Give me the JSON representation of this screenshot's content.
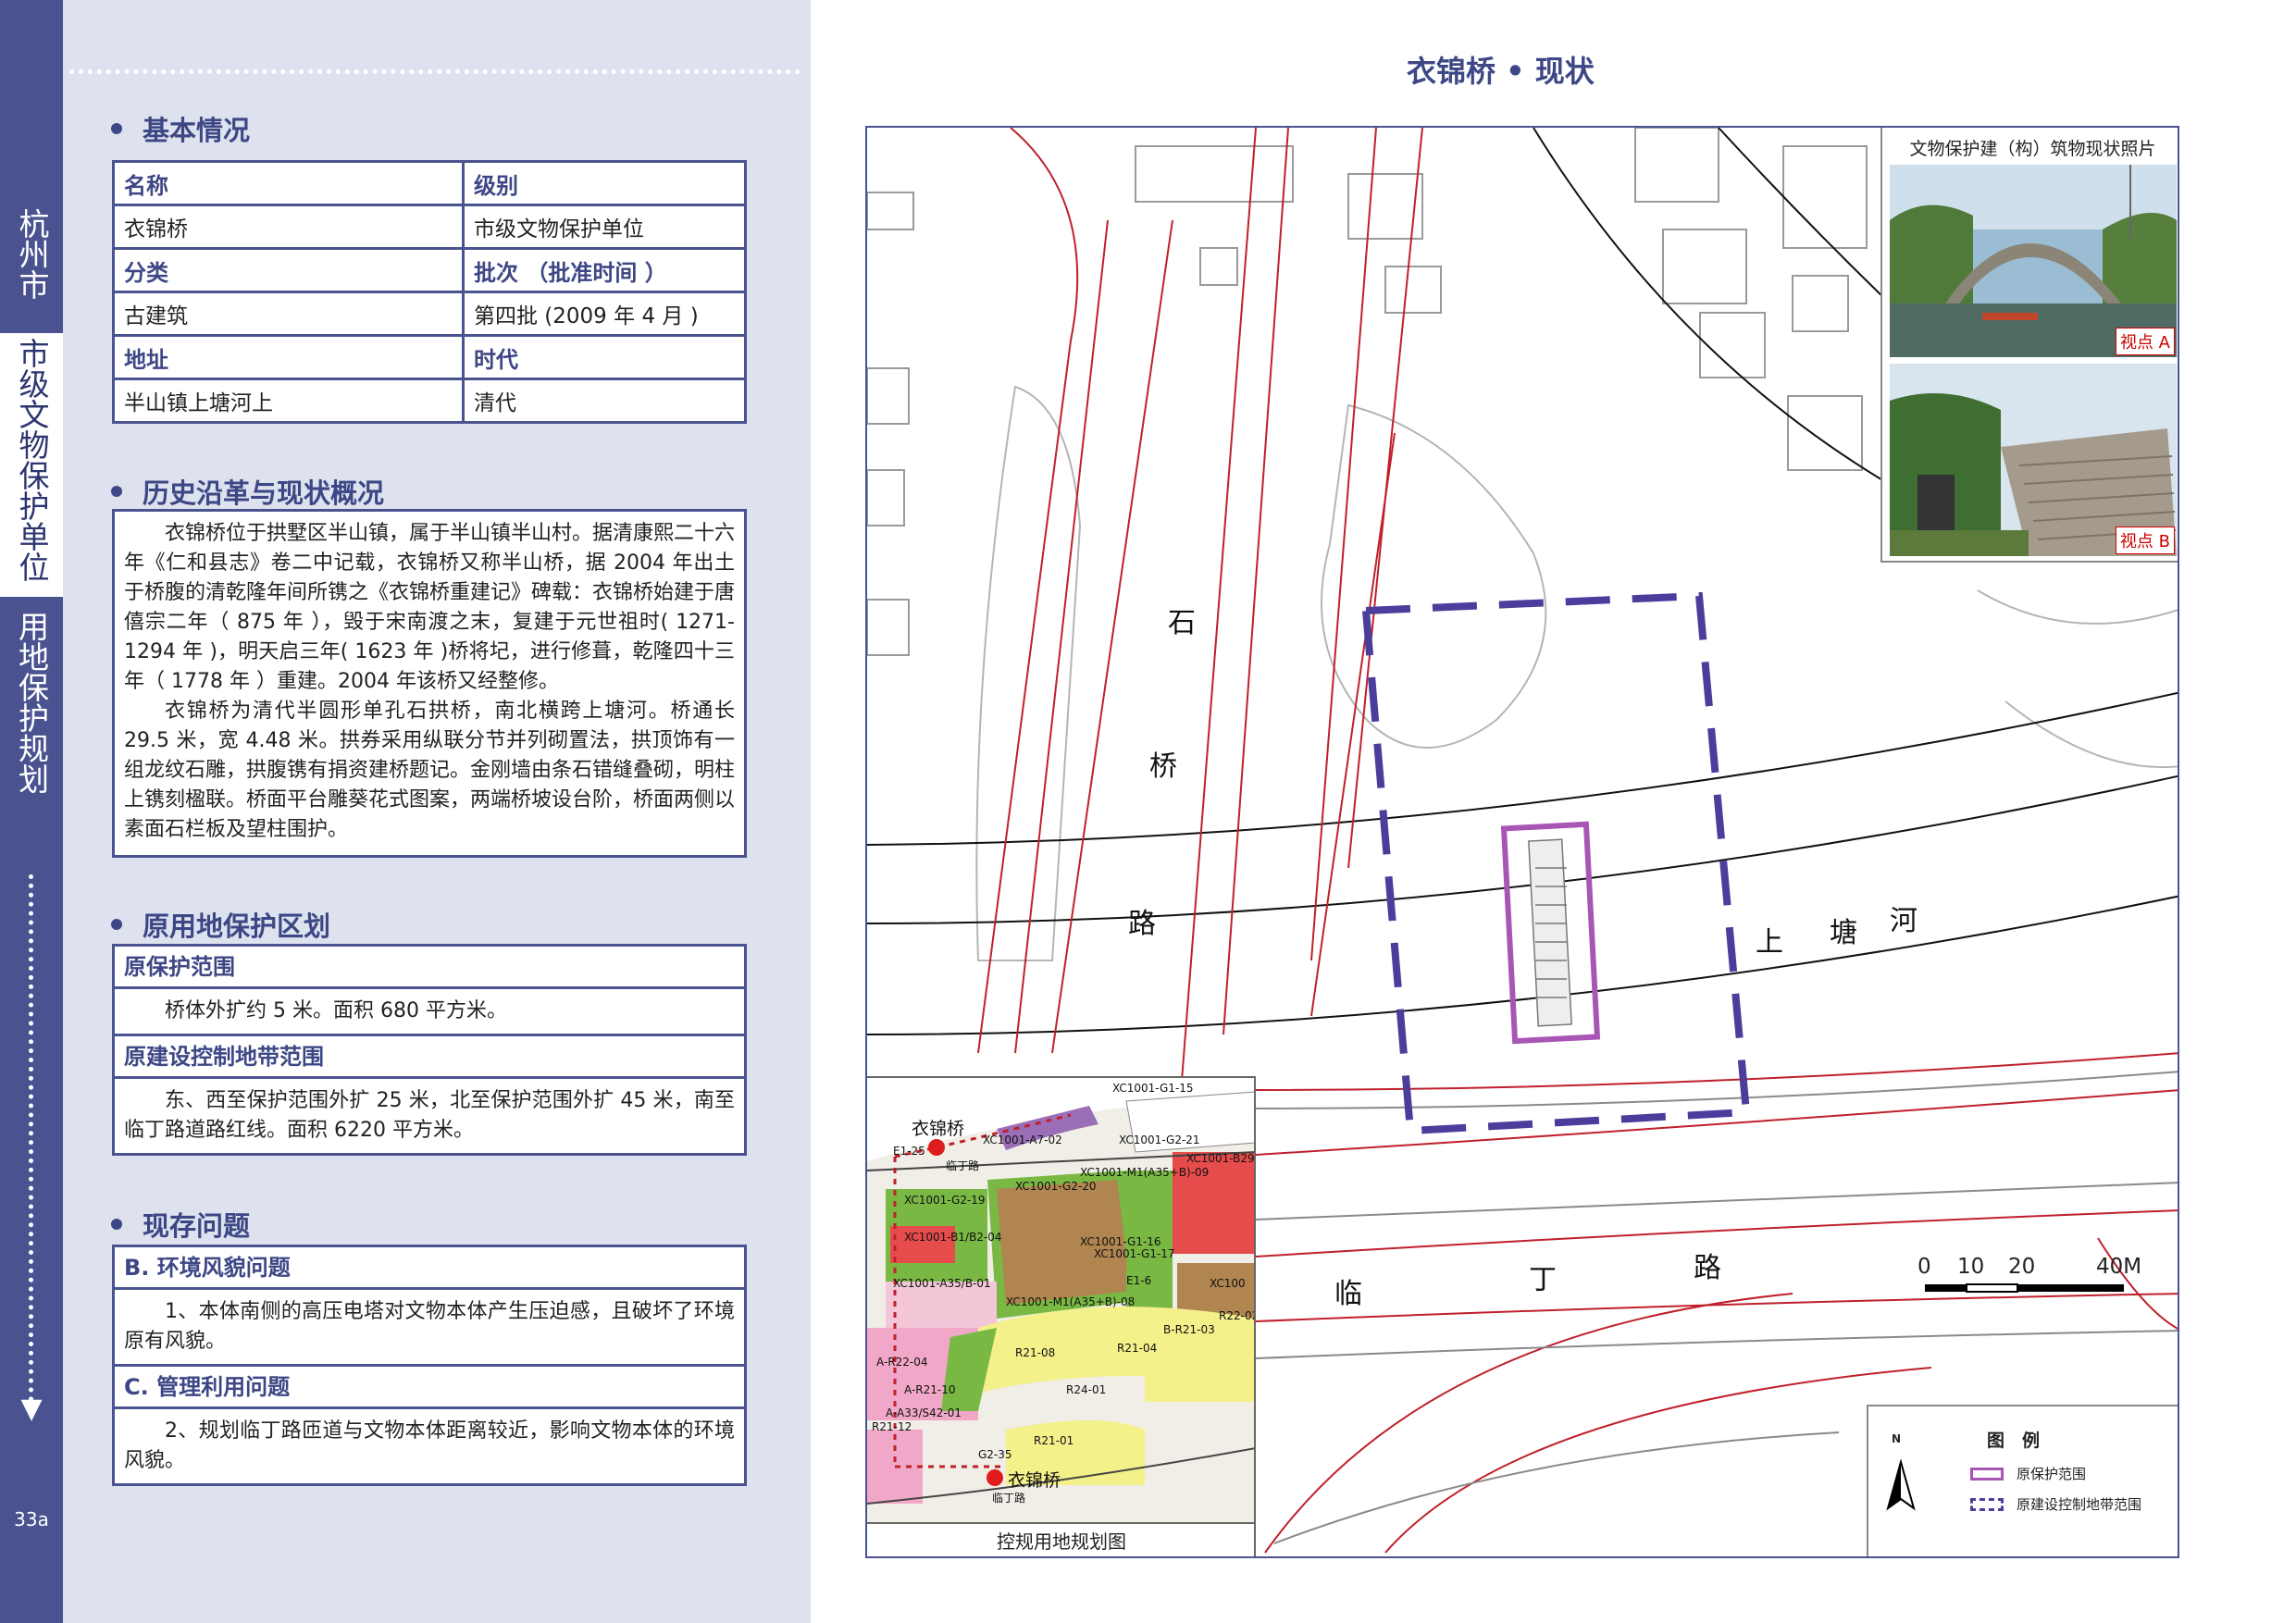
{
  "sidebar": {
    "city": "杭州市",
    "category": "市级文物保护单位",
    "plan": "用地保护规划",
    "page_number": "33a"
  },
  "sections": {
    "basic": "基本情况",
    "history": "历史沿革与现状概况",
    "protection": "原用地保护区划",
    "issues": "现存问题"
  },
  "basic_table": {
    "h_name": "名称",
    "h_level": "级别",
    "name": "衣锦桥",
    "level": "市级文物保护单位",
    "h_type": "分类",
    "h_batch": "批次 （批准时间 ）",
    "type": "古建筑",
    "batch": "第四批 (2009 年 4 月 )",
    "h_address": "地址",
    "h_era": "时代",
    "address": "半山镇上塘河上",
    "era": "清代"
  },
  "history_text": {
    "p1": "衣锦桥位于拱墅区半山镇，属于半山镇半山村。据清康熙二十六年《仁和县志》卷二中记载，衣锦桥又称半山桥，据 2004 年出土于桥腹的清乾隆年间所镌之《衣锦桥重建记》碑载：衣锦桥始建于唐僖宗二年（ 875 年 ），毁于宋南渡之末，复建于元世祖时( 1271-1294 年 )，明天启三年( 1623 年 )桥将圮，进行修葺，乾隆四十三年（ 1778 年 ）重建。2004 年该桥又经整修。",
    "p2": "衣锦桥为清代半圆形单孔石拱桥，南北横跨上塘河。桥通长 29.5 米，宽 4.48 米。拱券采用纵联分节并列砌置法，拱顶饰有一组龙纹石雕，拱腹镌有捐资建桥题记。金刚墙由条石错缝叠砌，明柱上镌刻楹联。桥面平台雕葵花式图案，两端桥坡设台阶，桥面两侧以素面石栏板及望柱围护。"
  },
  "protection": {
    "orig_scope_title": "原保护范围",
    "orig_scope_text": "桥体外扩约 5 米。面积 680 平方米。",
    "control_title": "原建设控制地带范围",
    "control_text": "东、西至保护范围外扩 25 米，北至保护范围外扩 45 米，南至临丁路道路红线。面积 6220 平方米。"
  },
  "issues": {
    "b_title": "B. 环境风貌问题",
    "b_text": "1、本体南侧的高压电塔对文物本体产生压迫感，且破坏了环境原有风貌。",
    "c_title": "C. 管理利用问题",
    "c_text": "2、规划临丁路匝道与文物本体距离较近，影响文物本体的环境风貌。"
  },
  "page_title": "衣锦桥 • 现状",
  "map": {
    "road_shiqiao": [
      "石",
      "桥",
      "路"
    ],
    "river": [
      "上",
      "塘",
      "河"
    ],
    "road_linding": [
      "临",
      "丁",
      "路"
    ],
    "photo_title": "文物保护建（构）筑物现状照片",
    "view_a": "视点 A",
    "view_b": "视点 B",
    "scale_labels": [
      "0",
      "10",
      "20",
      "40M"
    ],
    "legend_title": "图　例",
    "legend_protect": "原保护范围",
    "legend_control": "原建设控制地带范围",
    "north": "N",
    "inset_caption": "控规用地规划图",
    "inset_bridge_top": "衣锦桥",
    "inset_bridge_bottom": "衣锦桥",
    "inset_road_top": "临丁路",
    "inset_road_bottom": "临丁路",
    "inset_codes": [
      "XC1001-G1-15",
      "XC1001-A7-02",
      "XC1001-G2-21",
      "XC1001-B29-",
      "XC1001-M1(A35+B)-09",
      "XC1001-G2-19",
      "XC1001-G2-20",
      "XC1001-B1/B2-04",
      "XC1001-G1-16",
      "XC1001-G1-17",
      "XC1001-A35/B-01",
      "XC1001-M1(A35+B)-08",
      "E1-6",
      "XC100",
      "R21-08",
      "R21-04",
      "B-R21-03",
      "R22-02",
      "R24-01",
      "R21-01",
      "G2-35",
      "A-R21-10",
      "A-R22-04",
      "R21-12",
      "A-A33/S42-01",
      "E1-25"
    ],
    "colors": {
      "protect": "#a855b5",
      "control": "#4a3d9c",
      "road_red": "#c0202b",
      "frame": "#4a5390"
    }
  }
}
